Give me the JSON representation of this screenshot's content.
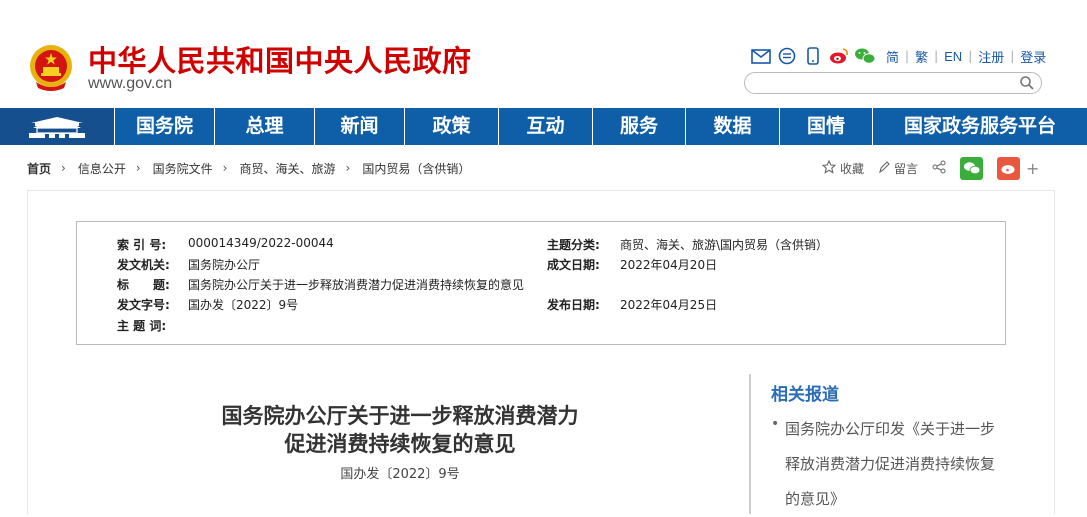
{
  "header": {
    "site_title": "中华人民共和国中央人民政府",
    "site_url": "www.gov.cn",
    "top_icons": [
      "mail-icon",
      "chat-icon",
      "mobile-icon",
      "weibo-icon",
      "wechat-icon"
    ],
    "top_links": [
      "简",
      "繁",
      "EN",
      "注册",
      "登录"
    ],
    "search_placeholder": ""
  },
  "nav": {
    "items": [
      "国务院",
      "总理",
      "新闻",
      "政策",
      "互动",
      "服务",
      "数据",
      "国情",
      "国家政务服务平台"
    ],
    "home_icon": "tiananmen-icon"
  },
  "breadcrumb": [
    "首页",
    "信息公开",
    "国务院文件",
    "商贸、海关、旅游",
    "国内贸易（含供销）"
  ],
  "tools": {
    "favorite": "收藏",
    "comment": "留言"
  },
  "meta": {
    "index_label": "索 引 号:",
    "index_value": "000014349/2022-00044",
    "topic_label": "主题分类:",
    "topic_value": "商贸、海关、旅游\\国内贸易（含供销）",
    "issuer_label": "发文机关:",
    "issuer_value": "国务院办公厅",
    "written_label": "成文日期:",
    "written_value": "2022年04月20日",
    "title_label": "标　　题:",
    "title_value": "国务院办公厅关于进一步释放消费潜力促进消费持续恢复的意见",
    "docno_label": "发文字号:",
    "docno_value": "国办发〔2022〕9号",
    "published_label": "发布日期:",
    "published_value": "2022年04月25日",
    "keywords_label": "主 题 词:",
    "keywords_value": ""
  },
  "document": {
    "title_line1": "国务院办公厅关于进一步释放消费潜力",
    "title_line2": "促进消费持续恢复的意见",
    "number": "国办发〔2022〕9号"
  },
  "related": {
    "heading": "相关报道",
    "items": [
      "国务院办公厅印发《关于进一步释放消费潜力促进消费持续恢复的意见》"
    ]
  },
  "colors": {
    "brand_red": "#d00000",
    "nav_blue": "#0e5ea8",
    "nav_home": "#154f8e",
    "link_blue": "#1a59a9",
    "related_blue": "#2a6db4"
  }
}
